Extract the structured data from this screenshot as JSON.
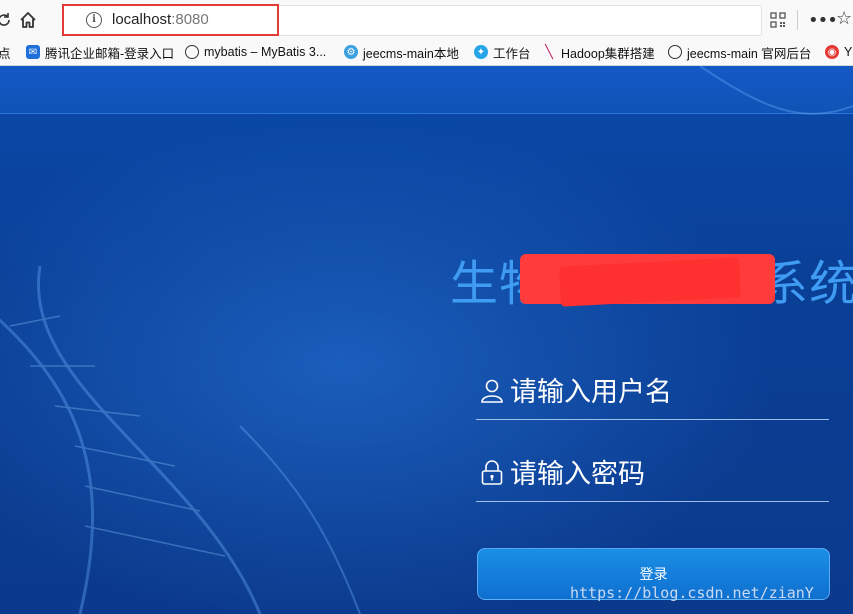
{
  "browser": {
    "url_host": "localhost",
    "url_port": ":8080",
    "bookmarks": [
      {
        "label": "点",
        "icon": "bookmark-folder-icon"
      },
      {
        "label": "腾讯企业邮箱-登录入口",
        "icon": "tencent-mail-icon"
      },
      {
        "label": "mybatis – MyBatis 3...",
        "icon": "globe-icon"
      },
      {
        "label": "jeecms-main本地",
        "icon": "jeecms-icon"
      },
      {
        "label": "工作台",
        "icon": "bird-icon"
      },
      {
        "label": "Hadoop集群搭建",
        "icon": "pen-icon"
      },
      {
        "label": "jeecms-main 官网后台",
        "icon": "globe-icon"
      },
      {
        "label": "Y",
        "icon": "weibo-icon"
      }
    ]
  },
  "login": {
    "title": "生物",
    "title_tail": "系统",
    "username_placeholder": "请输入用户名",
    "password_placeholder": "请输入密码",
    "submit_label": "登录"
  },
  "watermark": "https://blog.csdn.net/zianY",
  "colors": {
    "title": "#3f9cf2",
    "background": "#0a3f9a",
    "redaction": "#ff3b3b",
    "url_highlight": "#e53935"
  }
}
